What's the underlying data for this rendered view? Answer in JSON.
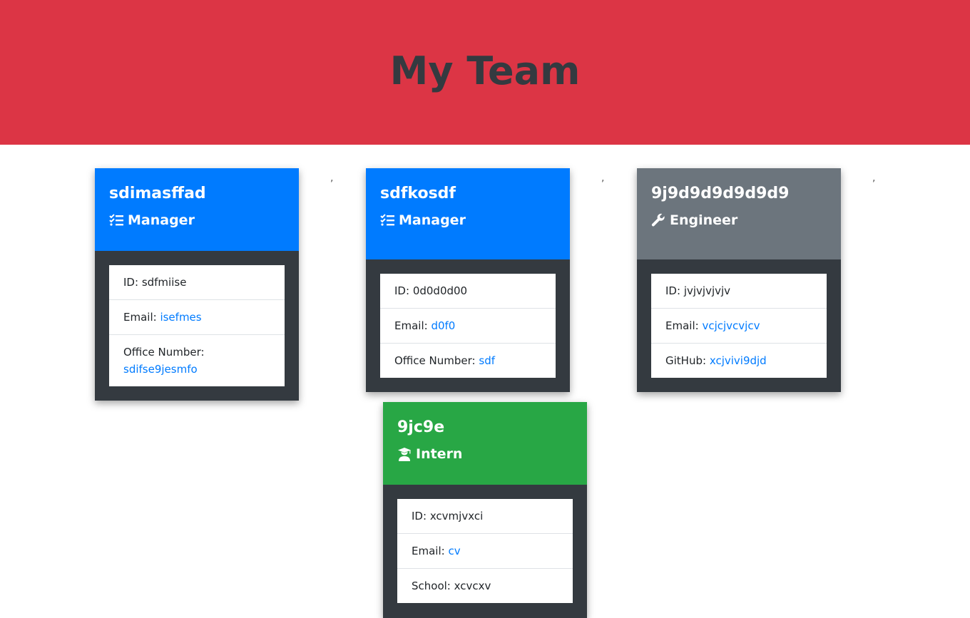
{
  "page": {
    "title": "My Team"
  },
  "cards": [
    {
      "name": "sdimasffad",
      "role": "Manager",
      "role_icon": "tasks-icon",
      "color": "#007bff",
      "id_label": "ID:",
      "id_value": "sdfmiise",
      "email_label": "Email:",
      "email_value": "isefmes",
      "extra_label": "Office Number:",
      "extra_value": "sdifse9jesmfo"
    },
    {
      "name": "sdfkosdf",
      "role": "Manager",
      "role_icon": "tasks-icon",
      "color": "#007bff",
      "id_label": "ID:",
      "id_value": "0d0d0d00",
      "email_label": "Email:",
      "email_value": "d0f0",
      "extra_label": "Office Number:",
      "extra_value": "sdf"
    },
    {
      "name": "9j9d9d9d9d9d9",
      "role": "Engineer",
      "role_icon": "wrench-icon",
      "color": "#6c757d",
      "id_label": "ID:",
      "id_value": "jvjvjvjvjv",
      "email_label": "Email:",
      "email_value": "vcjcjvcvjcv",
      "extra_label": "GitHub:",
      "extra_value": "xcjvivi9djd"
    },
    {
      "name": "9jc9e",
      "role": "Intern",
      "role_icon": "graduate-icon",
      "color": "#28a745",
      "id_label": "ID:",
      "id_value": "xcvmjvxci",
      "email_label": "Email:",
      "email_value": "cv",
      "extra_label": "School:",
      "extra_value": "xcvcxv"
    }
  ],
  "separators": [
    ",",
    ",",
    ","
  ]
}
